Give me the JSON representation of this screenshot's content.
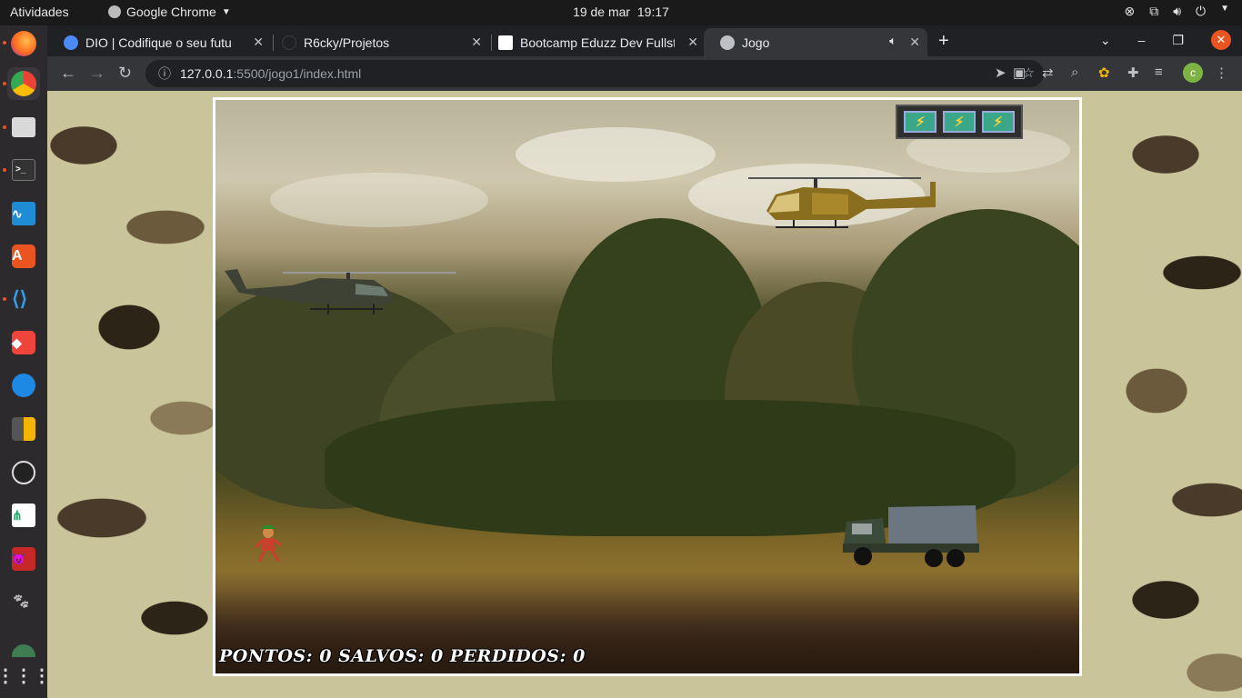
{
  "topbar": {
    "activities": "Atividades",
    "app_name": "Google Chrome",
    "date": "19 de mar",
    "time": "19:17"
  },
  "tabs": [
    {
      "title": "DIO | Codifique o seu futu",
      "favicon_color": "#4c8bf5"
    },
    {
      "title": "R6cky/Projetos",
      "favicon_color": "#202124"
    },
    {
      "title": "Bootcamp Eduzz Dev Fullst",
      "favicon_color": "#ffffff"
    },
    {
      "title": "Jogo",
      "favicon_color": "#bdc1c6"
    }
  ],
  "omnibox": {
    "host": "127.0.0.1",
    "path": ":5500/jogo1/index.html"
  },
  "profile_initial": "c",
  "game": {
    "score_label": "PONTOS: 0 SALVOS: 0 PERDIDOS: 0",
    "energy_cells": 3
  },
  "colors": {
    "accent": "#e95420",
    "chrome_dark": "#202124",
    "chrome_toolbar": "#35363a"
  }
}
